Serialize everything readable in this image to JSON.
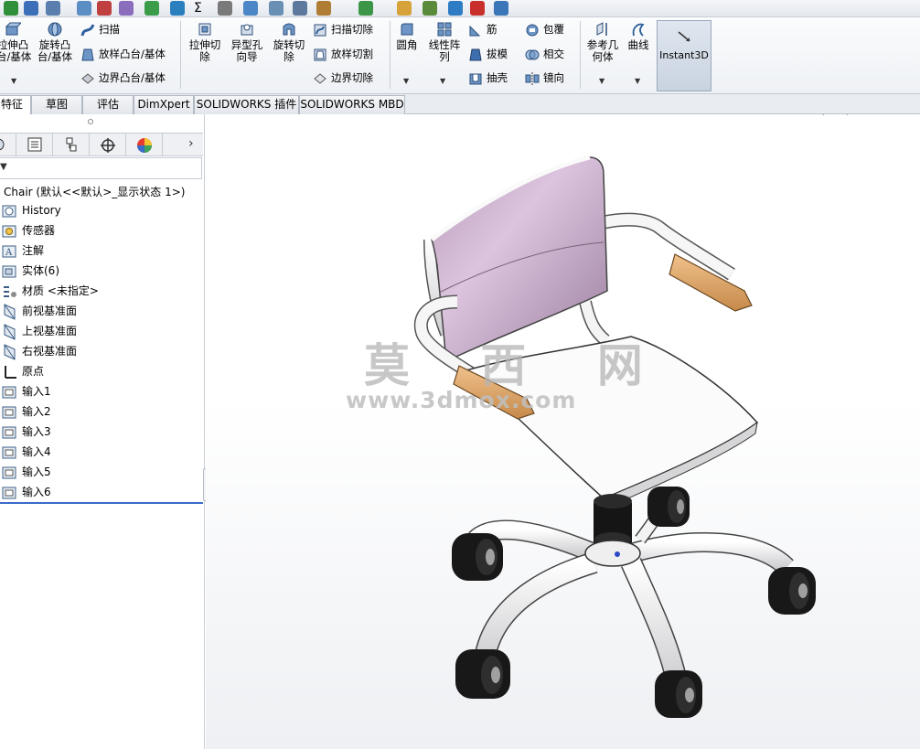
{
  "ribbon": {
    "features": {
      "extrude_boss": "拉伸凸\n台/基体",
      "revolve_boss": "旋转凸\n台/基体",
      "sweep": "扫描",
      "loft_boss": "放样凸台/基体",
      "boundary_boss": "边界凸台/基体",
      "extrude_cut": "拉伸切\n除",
      "hole_wizard": "异型孔\n向导",
      "revolve_cut": "旋转切\n除",
      "swept_cut": "扫描切除",
      "lofted_cut": "放样切割",
      "boundary_cut": "边界切除",
      "fillet": "圆角",
      "linear_pattern": "线性阵\n列",
      "rib": "筋",
      "draft": "拔模",
      "shell": "抽壳",
      "wrap": "包覆",
      "intersect": "相交",
      "mirror": "镜向",
      "ref_geometry": "参考几\n何体",
      "curves": "曲线",
      "instant3d": "Instant3D"
    }
  },
  "tabs": [
    "特征",
    "草图",
    "评估",
    "DimXpert",
    "SOLIDWORKS 插件",
    "SOLIDWORKS MBD"
  ],
  "feature_tree": {
    "root": "Chair (默认<<默认>_显示状态 1>)",
    "items": [
      {
        "label": "History",
        "icon": "history-icon"
      },
      {
        "label": "传感器",
        "icon": "sensor-icon"
      },
      {
        "label": "注解",
        "icon": "annotation-icon"
      },
      {
        "label": "实体(6)",
        "icon": "solid-bodies-icon"
      },
      {
        "label": "材质 <未指定>",
        "icon": "material-icon"
      },
      {
        "label": "前视基准面",
        "icon": "plane-icon"
      },
      {
        "label": "上视基准面",
        "icon": "plane-icon"
      },
      {
        "label": "右视基准面",
        "icon": "plane-icon"
      },
      {
        "label": "原点",
        "icon": "origin-icon"
      },
      {
        "label": "输入1",
        "icon": "imported-body-icon"
      },
      {
        "label": "输入2",
        "icon": "imported-body-icon"
      },
      {
        "label": "输入3",
        "icon": "imported-body-icon"
      },
      {
        "label": "输入4",
        "icon": "imported-body-icon"
      },
      {
        "label": "输入5",
        "icon": "imported-body-icon"
      },
      {
        "label": "输入6",
        "icon": "imported-body-icon"
      }
    ]
  },
  "watermark": {
    "text": "莫 西 网",
    "url": "www.3dmox.com"
  },
  "colors": {
    "accent": "#3a6bc8",
    "seat_back": "#c9a9cc",
    "armrest_pad": "#e2a86a",
    "frame": "#f2f2f2"
  }
}
